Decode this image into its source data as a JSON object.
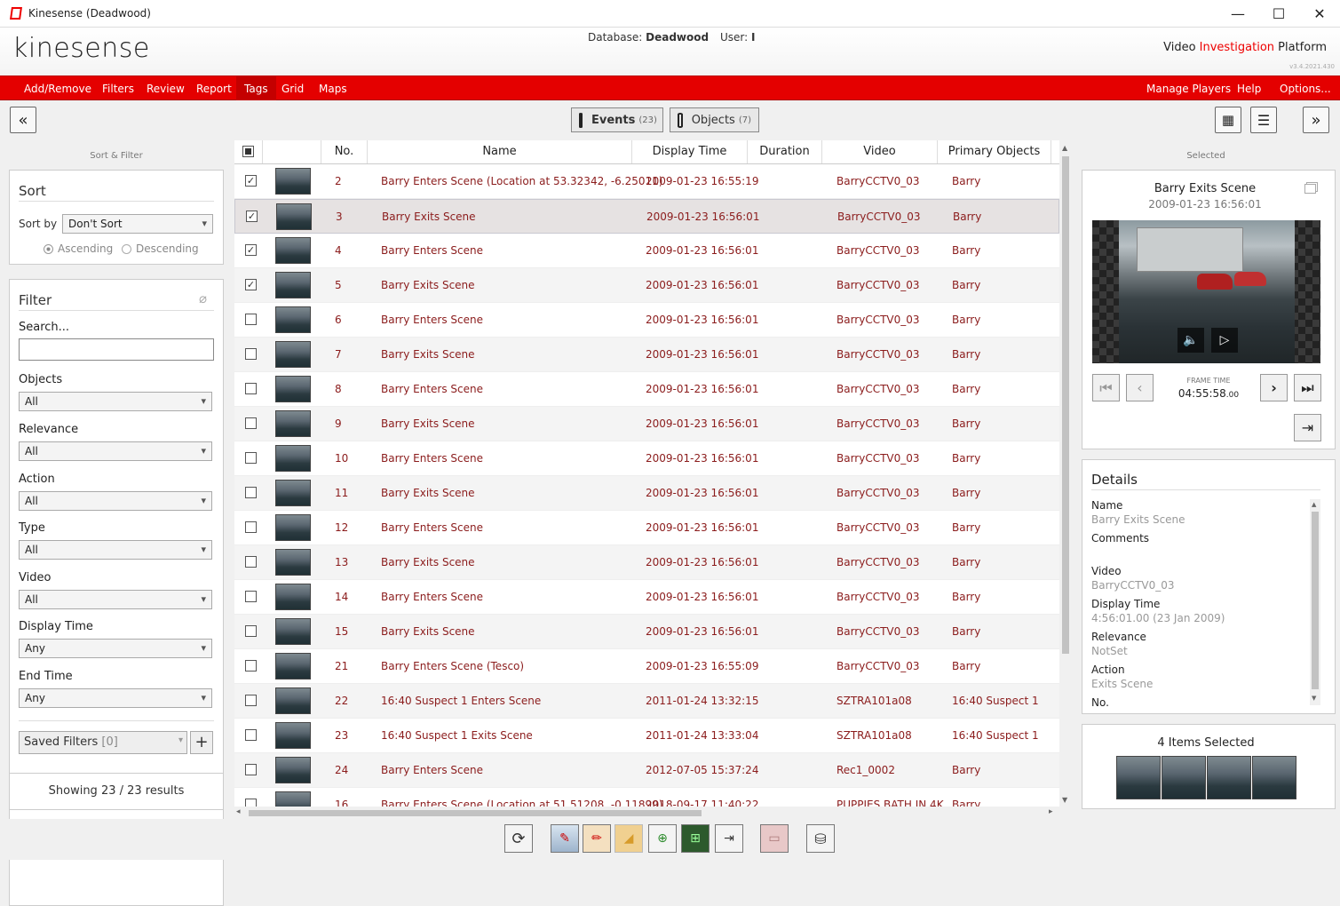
{
  "window": {
    "title": "Kinesense (Deadwood)",
    "minimize": "—",
    "maximize": "☐",
    "close": "✕"
  },
  "header": {
    "logo": "kinesense",
    "db_label": "Database:",
    "db_name": "Deadwood",
    "user_label": "User:",
    "user_name": "I",
    "platform_a": "Video ",
    "platform_b": "Investigation",
    "platform_c": " Platform",
    "version": "v3.4.2021.430"
  },
  "menu": {
    "left": [
      "Add/Remove",
      "Filters",
      "Review",
      "Report",
      "Tags",
      "Grid",
      "Maps"
    ],
    "right": [
      "Manage Players",
      "Help",
      "Options..."
    ],
    "active": "Tags"
  },
  "tabs": {
    "events_label": "Events",
    "events_count": "(23)",
    "objects_label": "Objects",
    "objects_count": "(7)"
  },
  "left": {
    "header": "Sort & Filter",
    "sort_title": "Sort",
    "sort_by_label": "Sort by",
    "sort_by_value": "Don't Sort",
    "ascending": "Ascending",
    "descending": "Descending",
    "filter_title": "Filter",
    "search_label": "Search...",
    "search_value": "",
    "filters": [
      {
        "label": "Objects",
        "value": "All"
      },
      {
        "label": "Relevance",
        "value": "All"
      },
      {
        "label": "Action",
        "value": "All"
      },
      {
        "label": "Type",
        "value": "All"
      },
      {
        "label": "Video",
        "value": "All"
      },
      {
        "label": "Display Time",
        "value": "Any"
      },
      {
        "label": "End Time",
        "value": "Any"
      }
    ],
    "saved_filters": "Saved Filters",
    "saved_count": "[0]",
    "results": "Showing 23 / 23 results"
  },
  "grid": {
    "columns": [
      "No.",
      "Name",
      "Display Time",
      "Duration",
      "Video",
      "Primary Objects"
    ],
    "rows": [
      {
        "no": "2",
        "name": "Barry Enters Scene  (Location at 53.32342, -6.25011)",
        "time": "2009-01-23 16:55:19",
        "dur": "",
        "video": "BarryCCTV0_03",
        "obj": "Barry",
        "checked": true
      },
      {
        "no": "3",
        "name": "Barry Exits Scene",
        "time": "2009-01-23 16:56:01",
        "dur": "",
        "video": "BarryCCTV0_03",
        "obj": "Barry",
        "checked": true
      },
      {
        "no": "4",
        "name": "Barry Enters Scene",
        "time": "2009-01-23 16:56:01",
        "dur": "",
        "video": "BarryCCTV0_03",
        "obj": "Barry",
        "checked": true
      },
      {
        "no": "5",
        "name": "Barry Exits Scene",
        "time": "2009-01-23 16:56:01",
        "dur": "",
        "video": "BarryCCTV0_03",
        "obj": "Barry",
        "checked": true
      },
      {
        "no": "6",
        "name": "Barry Enters Scene",
        "time": "2009-01-23 16:56:01",
        "dur": "",
        "video": "BarryCCTV0_03",
        "obj": "Barry",
        "checked": false
      },
      {
        "no": "7",
        "name": "Barry Exits Scene",
        "time": "2009-01-23 16:56:01",
        "dur": "",
        "video": "BarryCCTV0_03",
        "obj": "Barry",
        "checked": false
      },
      {
        "no": "8",
        "name": "Barry Enters Scene",
        "time": "2009-01-23 16:56:01",
        "dur": "",
        "video": "BarryCCTV0_03",
        "obj": "Barry",
        "checked": false
      },
      {
        "no": "9",
        "name": "Barry Exits Scene",
        "time": "2009-01-23 16:56:01",
        "dur": "",
        "video": "BarryCCTV0_03",
        "obj": "Barry",
        "checked": false
      },
      {
        "no": "10",
        "name": "Barry Enters Scene",
        "time": "2009-01-23 16:56:01",
        "dur": "",
        "video": "BarryCCTV0_03",
        "obj": "Barry",
        "checked": false
      },
      {
        "no": "11",
        "name": "Barry Exits Scene",
        "time": "2009-01-23 16:56:01",
        "dur": "",
        "video": "BarryCCTV0_03",
        "obj": "Barry",
        "checked": false
      },
      {
        "no": "12",
        "name": "Barry Enters Scene",
        "time": "2009-01-23 16:56:01",
        "dur": "",
        "video": "BarryCCTV0_03",
        "obj": "Barry",
        "checked": false
      },
      {
        "no": "13",
        "name": "Barry Exits Scene",
        "time": "2009-01-23 16:56:01",
        "dur": "",
        "video": "BarryCCTV0_03",
        "obj": "Barry",
        "checked": false
      },
      {
        "no": "14",
        "name": "Barry Enters Scene",
        "time": "2009-01-23 16:56:01",
        "dur": "",
        "video": "BarryCCTV0_03",
        "obj": "Barry",
        "checked": false
      },
      {
        "no": "15",
        "name": "Barry Exits Scene",
        "time": "2009-01-23 16:56:01",
        "dur": "",
        "video": "BarryCCTV0_03",
        "obj": "Barry",
        "checked": false
      },
      {
        "no": "21",
        "name": "Barry Enters Scene  (Tesco)",
        "time": "2009-01-23 16:55:09",
        "dur": "",
        "video": "BarryCCTV0_03",
        "obj": "Barry",
        "checked": false
      },
      {
        "no": "22",
        "name": "16:40 Suspect 1 Enters Scene",
        "time": "2011-01-24 13:32:15",
        "dur": "",
        "video": "SZTRA101a08",
        "obj": "16:40 Suspect 1",
        "checked": false
      },
      {
        "no": "23",
        "name": "16:40 Suspect 1 Exits Scene",
        "time": "2011-01-24 13:33:04",
        "dur": "",
        "video": "SZTRA101a08",
        "obj": "16:40 Suspect 1",
        "checked": false
      },
      {
        "no": "24",
        "name": "Barry Enters Scene",
        "time": "2012-07-05 15:37:24",
        "dur": "",
        "video": "Rec1_0002",
        "obj": "Barry",
        "checked": false
      },
      {
        "no": "16",
        "name": "Barry Enters Scene  (Location at 51.51208, -0.11899)",
        "time": "2018-09-17 11:40:22",
        "dur": "",
        "video": "PUPPIES BATH IN 4K",
        "obj": "Barry",
        "checked": false
      }
    ]
  },
  "right": {
    "header": "Selected",
    "clip_title": "Barry Exits Scene",
    "clip_time": "2009-01-23 16:56:01",
    "frame_time_label": "FRAME TIME",
    "frame_time": "04:55:58",
    "frame_time_ms": ".00",
    "details_title": "Details",
    "details": [
      {
        "label": "Name",
        "value": "Barry Exits Scene"
      },
      {
        "label": "Comments",
        "value": ""
      },
      {
        "label": "Video",
        "value": "BarryCCTV0_03"
      },
      {
        "label": "Display Time",
        "value": "4:56:01.00 (23 Jan 2009)"
      },
      {
        "label": "Relevance",
        "value": "NotSet"
      },
      {
        "label": "Action",
        "value": "Exits Scene"
      },
      {
        "label": "No.",
        "value": ""
      }
    ],
    "items_selected": "4 Items Selected"
  },
  "colors": {
    "accent": "#e40000",
    "row_text": "#8b1c1c"
  }
}
